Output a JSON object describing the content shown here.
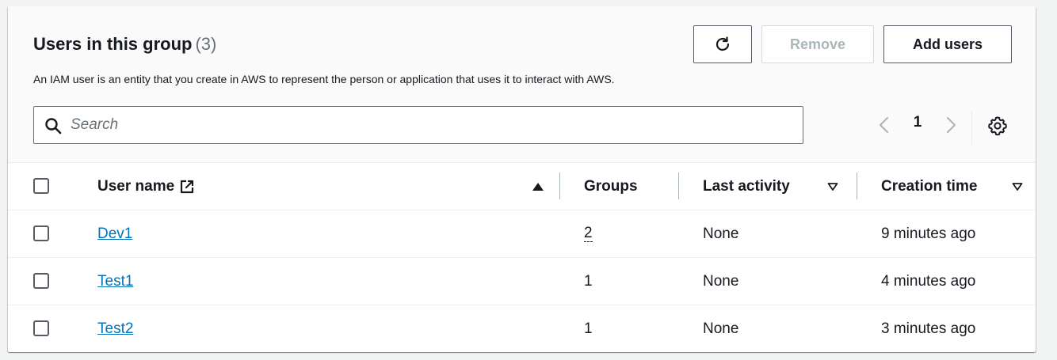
{
  "header": {
    "title": "Users in this group",
    "count": "(3)",
    "description": "An IAM user is an entity that you create in AWS to represent the person or application that uses it to interact with AWS."
  },
  "toolbar": {
    "refresh_icon": "refresh-icon",
    "remove_label": "Remove",
    "add_label": "Add users"
  },
  "search": {
    "placeholder": "Search",
    "value": "",
    "icon": "search-icon"
  },
  "pagination": {
    "current_page": "1",
    "prev_icon": "chevron-left-icon",
    "next_icon": "chevron-right-icon",
    "settings_icon": "gear-icon"
  },
  "table": {
    "columns": [
      {
        "label": "User name",
        "icon": "external-link-icon",
        "sort": "ascending"
      },
      {
        "label": "Groups"
      },
      {
        "label": "Last activity",
        "sort": "sortable"
      },
      {
        "label": "Creation time",
        "sort": "sortable"
      }
    ],
    "rows": [
      {
        "user_name": "Dev1",
        "groups": "2",
        "last_activity": "None",
        "creation_time": "9 minutes ago"
      },
      {
        "user_name": "Test1",
        "groups": "1",
        "last_activity": "None",
        "creation_time": "4 minutes ago"
      },
      {
        "user_name": "Test2",
        "groups": "1",
        "last_activity": "None",
        "creation_time": "3 minutes ago"
      }
    ]
  },
  "colors": {
    "link": "#0073bb",
    "border": "#545b64",
    "disabled": "#aab7b8",
    "header_bg": "#fafafa"
  }
}
